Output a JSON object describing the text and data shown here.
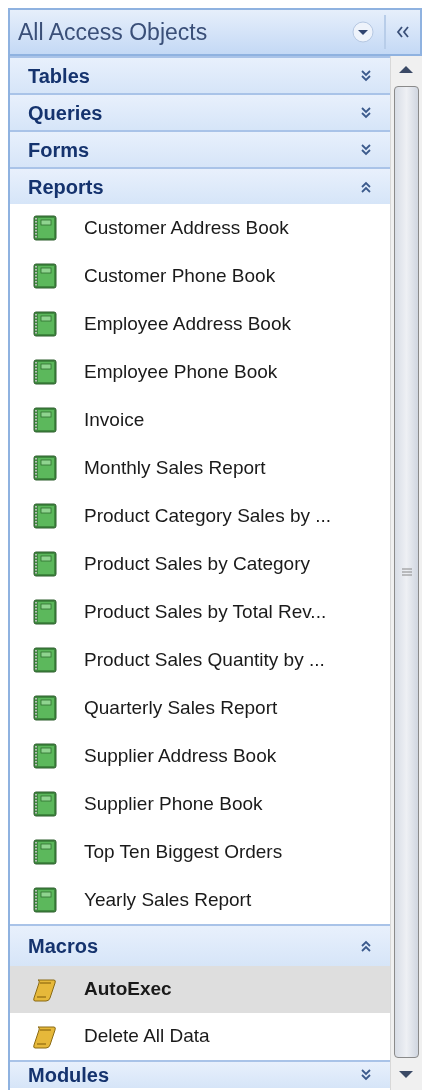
{
  "pane": {
    "title": "All Access Objects"
  },
  "groups": [
    {
      "name": "Tables",
      "expanded": false
    },
    {
      "name": "Queries",
      "expanded": false
    },
    {
      "name": "Forms",
      "expanded": false
    },
    {
      "name": "Reports",
      "expanded": true,
      "items": [
        {
          "label": "Customer Address Book",
          "kind": "report",
          "selected": false
        },
        {
          "label": "Customer Phone Book",
          "kind": "report",
          "selected": false
        },
        {
          "label": "Employee Address Book",
          "kind": "report",
          "selected": false
        },
        {
          "label": "Employee Phone Book",
          "kind": "report",
          "selected": false
        },
        {
          "label": "Invoice",
          "kind": "report",
          "selected": false
        },
        {
          "label": "Monthly Sales Report",
          "kind": "report",
          "selected": false
        },
        {
          "label": "Product Category Sales by ...",
          "kind": "report",
          "selected": false
        },
        {
          "label": "Product Sales by Category",
          "kind": "report",
          "selected": false
        },
        {
          "label": "Product Sales by Total Rev...",
          "kind": "report",
          "selected": false
        },
        {
          "label": "Product Sales Quantity by ...",
          "kind": "report",
          "selected": false
        },
        {
          "label": "Quarterly Sales Report",
          "kind": "report",
          "selected": false
        },
        {
          "label": "Supplier Address Book",
          "kind": "report",
          "selected": false
        },
        {
          "label": "Supplier Phone Book",
          "kind": "report",
          "selected": false
        },
        {
          "label": "Top Ten Biggest Orders",
          "kind": "report",
          "selected": false
        },
        {
          "label": "Yearly Sales Report",
          "kind": "report",
          "selected": false
        }
      ]
    },
    {
      "name": "Macros",
      "expanded": true,
      "items": [
        {
          "label": "AutoExec",
          "kind": "macro",
          "selected": true
        },
        {
          "label": "Delete All Data",
          "kind": "macro",
          "selected": false
        }
      ]
    },
    {
      "name": "Modules",
      "expanded": false
    }
  ]
}
